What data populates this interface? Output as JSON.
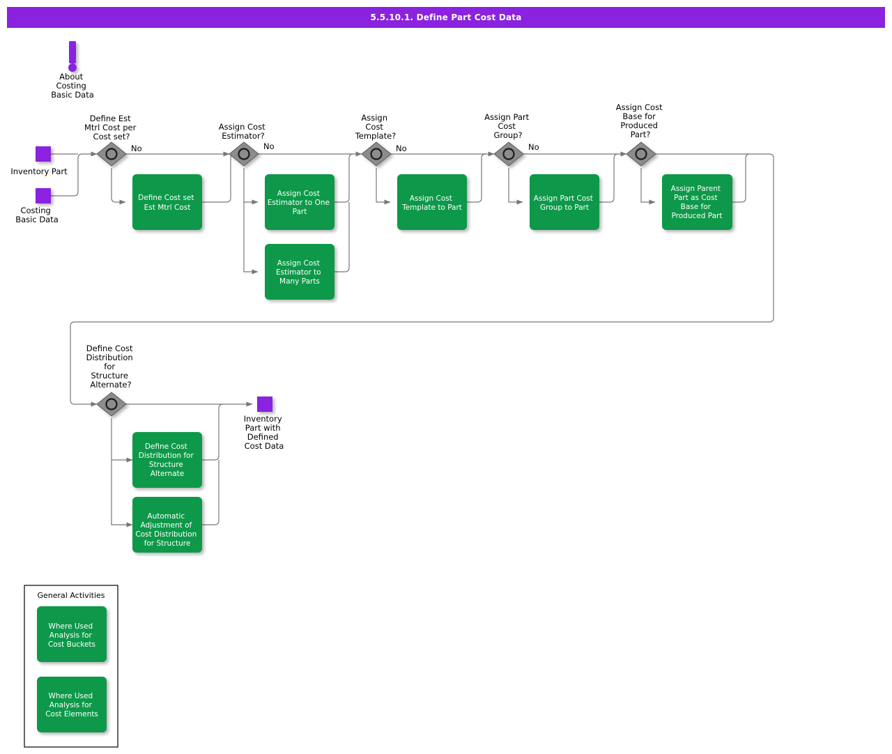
{
  "header": {
    "title": "5.5.10.1. Define Part Cost Data"
  },
  "colors": {
    "header_bg": "#8a22e0",
    "task_green": "#089949",
    "start_purple": "#8a22e0",
    "gateway_gray": "#8c8c8c",
    "connector_gray": "#777777",
    "text_white": "#ffffff",
    "text_black": "#000000"
  },
  "note": {
    "icon": "exclamation-icon",
    "label": "About\nCosting\nBasic Data",
    "lines": [
      "About",
      "Costing",
      "Basic Data"
    ]
  },
  "start_events": [
    {
      "id": "inventory-part",
      "lines": [
        "Inventory Part"
      ]
    },
    {
      "id": "costing-basic-data",
      "lines": [
        "Costing",
        "Basic Data"
      ]
    }
  ],
  "end_events": [
    {
      "id": "inventory-part-with-defined-cost-data",
      "lines": [
        "Inventory",
        "Part with",
        "Defined",
        "Cost Data"
      ]
    }
  ],
  "gateways": [
    {
      "id": "define-est-mtrl-cost-per-cost-set",
      "lines": [
        "Define Est",
        "Mtrl Cost per",
        "Cost set?"
      ],
      "no_label": "No"
    },
    {
      "id": "assign-cost-estimator",
      "lines": [
        "Assign Cost",
        "Estimator?"
      ],
      "no_label": "No"
    },
    {
      "id": "assign-cost-template",
      "lines": [
        "Assign",
        "Cost",
        "Template?"
      ],
      "no_label": "No"
    },
    {
      "id": "assign-part-cost-group",
      "lines": [
        "Assign Part",
        "Cost",
        "Group?"
      ],
      "no_label": "No"
    },
    {
      "id": "assign-cost-base-for-produced-part",
      "lines": [
        "Assign Cost",
        "Base for",
        "Produced",
        "Part?"
      ],
      "no_label": ""
    },
    {
      "id": "define-cost-distribution-for-structure-alternate",
      "lines": [
        "Define Cost",
        "Distribution",
        "for",
        "Structure",
        "Alternate?"
      ],
      "no_label": ""
    }
  ],
  "tasks": [
    {
      "id": "define-cost-set-est-mtrl-cost",
      "lines": [
        "Define Cost set",
        "Est Mtrl Cost"
      ]
    },
    {
      "id": "assign-cost-estimator-to-one-part",
      "lines": [
        "Assign Cost",
        "Estimator to One",
        "Part"
      ]
    },
    {
      "id": "assign-cost-estimator-to-many-parts",
      "lines": [
        "Assign Cost",
        "Estimator to",
        "Many Parts"
      ]
    },
    {
      "id": "assign-cost-template-to-part",
      "lines": [
        "Assign Cost",
        "Template to Part"
      ]
    },
    {
      "id": "assign-part-cost-group-to-part",
      "lines": [
        "Assign Part Cost",
        "Group to Part"
      ]
    },
    {
      "id": "assign-parent-part-as-cost-base-for-produced-part",
      "lines": [
        "Assign Parent",
        "Part as Cost",
        "Base for",
        "Produced Part"
      ]
    },
    {
      "id": "define-cost-distribution-for-structure-alternate",
      "lines": [
        "Define Cost",
        "Distribution for",
        "Structure",
        "Alternate"
      ]
    },
    {
      "id": "automatic-adjustment-of-cost-distribution-for-structure",
      "lines": [
        "Automatic",
        "Adjustment of",
        "Cost Distribution",
        "for Structure"
      ]
    }
  ],
  "legend": {
    "title": "General Activities",
    "tasks": [
      {
        "id": "where-used-analysis-for-cost-buckets",
        "lines": [
          "Where Used",
          "Analysis for",
          "Cost Buckets"
        ]
      },
      {
        "id": "where-used-analysis-for-cost-elements",
        "lines": [
          "Where Used",
          "Analysis for",
          "Cost Elements"
        ]
      }
    ]
  }
}
